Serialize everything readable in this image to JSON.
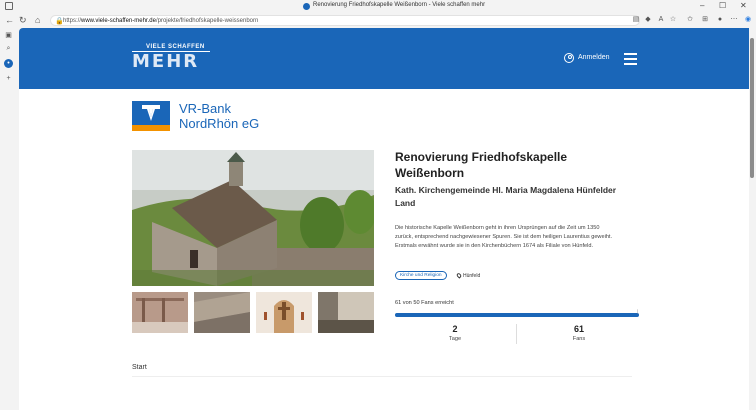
{
  "browser": {
    "window_title": "Renovierung Friedhofskapelle Weißenborn - Viele schaffen mehr",
    "url_prefix": "https://",
    "url_host": "www.viele-schaffen-mehr.de",
    "url_path": "/projekte/friedhofskapelle-weissenborn"
  },
  "site": {
    "logo_small": "VIELE SCHAFFEN",
    "logo_big": "MEHR",
    "login_label": "Anmelden",
    "brand_color": "#1a66b8"
  },
  "bank": {
    "line1": "VR-Bank",
    "line2": "NordRhön eG"
  },
  "project": {
    "title_line1": "Renovierung Friedhofskapelle",
    "title_line2": "Weißenborn",
    "organization_line1": "Kath. Kirchengemeinde Hl. Maria Magdalena Hünfelder",
    "organization_line2": "Land",
    "description_line1": "Die historische Kapelle Weißenborn geht in ihren Ursprüngen auf die Zeit um 1350",
    "description_line2": "zurück, entsprechend nachgewiesener Spuren. Sie ist dem heiligen Laurentius geweiht.",
    "description_line3": "Erstmals erwähnt wurde sie in den Kirchenbüchern 1674 als Filiale von Hünfeld.",
    "category": "Kirche und Religion",
    "location": "Hünfeld",
    "fans_text": "61 von 50 Fans erreicht",
    "fans_progress_fraction": 1.0,
    "days_value": "2",
    "days_label": "Tage",
    "fans_value": "61",
    "fans_label": "Fans"
  },
  "section": {
    "start_label": "Start"
  }
}
